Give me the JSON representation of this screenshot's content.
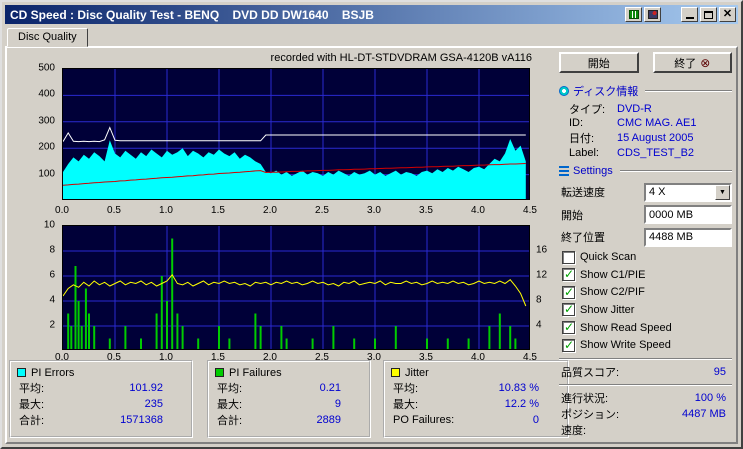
{
  "window": {
    "title": "CD Speed : Disc Quality Test - BENQ    DVD DD DW1640    BSJB"
  },
  "tab": {
    "label": "Disc Quality"
  },
  "chart_header": "recorded with HL-DT-STDVDRAM GSA-4120B vA116",
  "actions": {
    "start": "開始",
    "exit": "終了"
  },
  "disc_info": {
    "header": "ディスク情報",
    "rows": [
      {
        "label": "タイプ:",
        "value": "DVD-R"
      },
      {
        "label": "ID:",
        "value": "CMC MAG. AE1"
      },
      {
        "label": "日付:",
        "value": "15 August 2005"
      },
      {
        "label": "Label:",
        "value": "CDS_TEST_B2"
      }
    ]
  },
  "settings": {
    "header": "Settings",
    "speed_label": "転送速度",
    "speed_value": "4 X",
    "start_label": "開始",
    "start_value": "0000 MB",
    "end_label": "終了位置",
    "end_value": "4488 MB",
    "checkboxes": [
      {
        "label": "Quick Scan",
        "checked": false
      },
      {
        "label": "Show C1/PIE",
        "checked": true
      },
      {
        "label": "Show C2/PIF",
        "checked": true
      },
      {
        "label": "Show Jitter",
        "checked": true
      },
      {
        "label": "Show Read Speed",
        "checked": true
      },
      {
        "label": "Show Write Speed",
        "checked": true
      }
    ]
  },
  "score": {
    "label": "品質スコア:",
    "value": "95"
  },
  "status": [
    {
      "label": "進行状況:",
      "value": "100 %"
    },
    {
      "label": "ポジション:",
      "value": "4487 MB"
    },
    {
      "label": "速度:",
      "value": ""
    }
  ],
  "stats_panels": [
    {
      "legend": "PI Errors",
      "color": "#00FFFF",
      "rows": [
        {
          "label": "平均:",
          "value": "101.92"
        },
        {
          "label": "最大:",
          "value": "235"
        },
        {
          "label": "合計:",
          "value": "1571368"
        }
      ]
    },
    {
      "legend": "PI Failures",
      "color": "#00CC00",
      "rows": [
        {
          "label": "平均:",
          "value": "0.21"
        },
        {
          "label": "最大:",
          "value": "9"
        },
        {
          "label": "合計:",
          "value": "2889"
        }
      ]
    },
    {
      "legend": "Jitter",
      "color": "#FFFF00",
      "rows": [
        {
          "label": "平均:",
          "value": "10.83 %"
        },
        {
          "label": "最大:",
          "value": "12.2 %"
        },
        {
          "label": "PO Failures:",
          "value": "0"
        }
      ]
    }
  ],
  "chart_data": {
    "top": {
      "type": "area",
      "title": "recorded with HL-DT-STDVDRAM GSA-4120B vA116",
      "x_step": 0.05,
      "x_max": 4.5,
      "y_range": [
        0,
        500
      ],
      "y_ticks": [
        500,
        400,
        300,
        200,
        100
      ],
      "x_ticks": [
        "0.0",
        "0.5",
        "1.0",
        "1.5",
        "2.0",
        "2.5",
        "3.0",
        "3.5",
        "4.0",
        "4.5"
      ],
      "grid_y": [
        100,
        200,
        300,
        400
      ],
      "grid_x": [
        0.5,
        1,
        1.5,
        2,
        2.5,
        3,
        3.5,
        4
      ],
      "grid_color": "#2a2ad0",
      "bg_color": "#000038",
      "series": [
        {
          "name": "PI Errors",
          "color": "#00FFFF",
          "style": "area",
          "values": [
            110,
            140,
            165,
            150,
            175,
            160,
            185,
            170,
            150,
            230,
            180,
            165,
            190,
            175,
            160,
            185,
            170,
            195,
            180,
            165,
            190,
            175,
            185,
            200,
            170,
            190,
            180,
            165,
            185,
            175,
            195,
            180,
            170,
            185,
            160,
            175,
            165,
            150,
            140,
            110,
            105,
            115,
            100,
            110,
            95,
            105,
            115,
            100,
            110,
            105,
            95,
            110,
            100,
            115,
            105,
            95,
            110,
            100,
            105,
            115,
            100,
            110,
            95,
            105,
            115,
            100,
            110,
            105,
            95,
            110,
            115,
            105,
            120,
            110,
            125,
            115,
            130,
            120,
            110,
            125,
            130,
            120,
            140,
            160,
            150,
            180,
            235,
            190,
            210,
            150
          ]
        },
        {
          "name": "Write Speed",
          "color": "#D40000",
          "style": "line",
          "values": [
            60,
            61,
            63,
            64,
            66,
            67,
            69,
            70,
            72,
            73,
            74,
            76,
            77,
            79,
            80,
            82,
            83,
            85,
            86,
            88,
            89,
            90,
            92,
            93,
            95,
            96,
            98,
            99,
            101,
            102,
            104,
            105,
            106,
            108,
            109,
            111,
            112,
            114,
            115,
            108,
            109,
            109,
            110,
            111,
            112,
            112,
            113,
            114,
            114,
            115,
            116,
            116,
            117,
            118,
            118,
            119,
            120,
            120,
            121,
            122,
            122,
            123,
            124,
            124,
            125,
            126,
            126,
            127,
            128,
            128,
            129,
            130,
            130,
            131,
            132,
            132,
            133,
            134,
            134,
            135,
            136,
            136,
            137,
            138,
            138,
            139,
            140,
            140,
            141,
            142
          ]
        },
        {
          "name": "Read Speed",
          "color": "#FFFFFF",
          "style": "line",
          "values": [
            225,
            258,
            226,
            225,
            226,
            225,
            226,
            225,
            232,
            278,
            230,
            228,
            228,
            228,
            228,
            228,
            228,
            228,
            228,
            228,
            228,
            228,
            228,
            228,
            228,
            228,
            228,
            228,
            228,
            228,
            228,
            228,
            228,
            228,
            228,
            228,
            228,
            228,
            228,
            250,
            250,
            250,
            250,
            250,
            250,
            250,
            250,
            250,
            250,
            250,
            250,
            250,
            250,
            250,
            250,
            250,
            250,
            250,
            250,
            250,
            250,
            250,
            250,
            250,
            250,
            250,
            250,
            250,
            250,
            250,
            250,
            250,
            250,
            250,
            250,
            250,
            250,
            250,
            250,
            250,
            250,
            250,
            250,
            250,
            250,
            250,
            250,
            250,
            250,
            250
          ]
        }
      ]
    },
    "bottom": {
      "type": "bar",
      "x_step": 0.05,
      "x_max": 4.5,
      "y_range": [
        0,
        10
      ],
      "y_ticks": [
        10,
        8,
        6,
        4,
        2
      ],
      "y2_range": [
        0,
        20
      ],
      "y2_ticks": [
        16,
        12,
        8,
        4
      ],
      "x_ticks": [
        "0.0",
        "0.5",
        "1.0",
        "1.5",
        "2.0",
        "2.5",
        "3.0",
        "3.5",
        "4.0",
        "4.5"
      ],
      "grid_y": [
        2,
        4,
        6,
        8
      ],
      "grid_x": [
        0.5,
        1,
        1.5,
        2,
        2.5,
        3,
        3.5,
        4
      ],
      "grid_color": "#2a2ad0",
      "bg_color": "#000038",
      "series": [
        {
          "name": "PI Failures",
          "color": "#00CC00",
          "style": "bars",
          "points": [
            [
              0.05,
              3
            ],
            [
              0.08,
              2
            ],
            [
              0.12,
              6.8
            ],
            [
              0.15,
              4
            ],
            [
              0.18,
              2
            ],
            [
              0.22,
              5
            ],
            [
              0.25,
              3
            ],
            [
              0.3,
              2
            ],
            [
              0.45,
              1
            ],
            [
              0.6,
              2
            ],
            [
              0.75,
              1
            ],
            [
              0.9,
              3
            ],
            [
              0.95,
              6
            ],
            [
              1.0,
              4
            ],
            [
              1.05,
              9
            ],
            [
              1.1,
              3
            ],
            [
              1.15,
              2
            ],
            [
              1.3,
              1
            ],
            [
              1.5,
              2
            ],
            [
              1.6,
              1
            ],
            [
              1.85,
              3
            ],
            [
              1.9,
              2
            ],
            [
              2.1,
              2
            ],
            [
              2.15,
              1
            ],
            [
              2.4,
              1
            ],
            [
              2.6,
              2
            ],
            [
              2.8,
              1
            ],
            [
              3.0,
              1
            ],
            [
              3.2,
              2
            ],
            [
              3.5,
              1
            ],
            [
              3.7,
              1
            ],
            [
              3.9,
              1
            ],
            [
              4.1,
              2
            ],
            [
              4.2,
              3
            ],
            [
              4.3,
              2
            ],
            [
              4.35,
              1
            ]
          ]
        },
        {
          "name": "Jitter",
          "color": "#FFFF00",
          "style": "line",
          "axis": "y2",
          "values": [
            8.8,
            10.0,
            10.6,
            10.2,
            11.0,
            10.4,
            11.2,
            10.6,
            11.0,
            10.4,
            10.8,
            11.2,
            10.6,
            11.0,
            10.8,
            11.2,
            10.6,
            11.0,
            10.4,
            10.8,
            11.2,
            12.2,
            10.8,
            10.6,
            11.0,
            10.4,
            10.8,
            11.2,
            10.6,
            11.0,
            10.8,
            11.2,
            10.8,
            11.0,
            10.6,
            10.8,
            10.4,
            11.0,
            10.8,
            11.0,
            10.6,
            11.0,
            10.8,
            11.2,
            10.8,
            11.0,
            10.6,
            10.8,
            11.2,
            10.8,
            11.0,
            10.6,
            10.8,
            10.4,
            11.0,
            10.8,
            11.2,
            10.6,
            10.8,
            11.0,
            10.8,
            11.2,
            10.6,
            11.0,
            10.8,
            10.8,
            11.2,
            10.8,
            11.0,
            10.6,
            10.8,
            11.2,
            10.8,
            11.0,
            10.8,
            11.2,
            10.8,
            11.0,
            10.6,
            10.8,
            11.2,
            10.8,
            11.0,
            10.8,
            11.2,
            10.8,
            11.4,
            10.4,
            9.2,
            7.2
          ]
        }
      ]
    }
  }
}
